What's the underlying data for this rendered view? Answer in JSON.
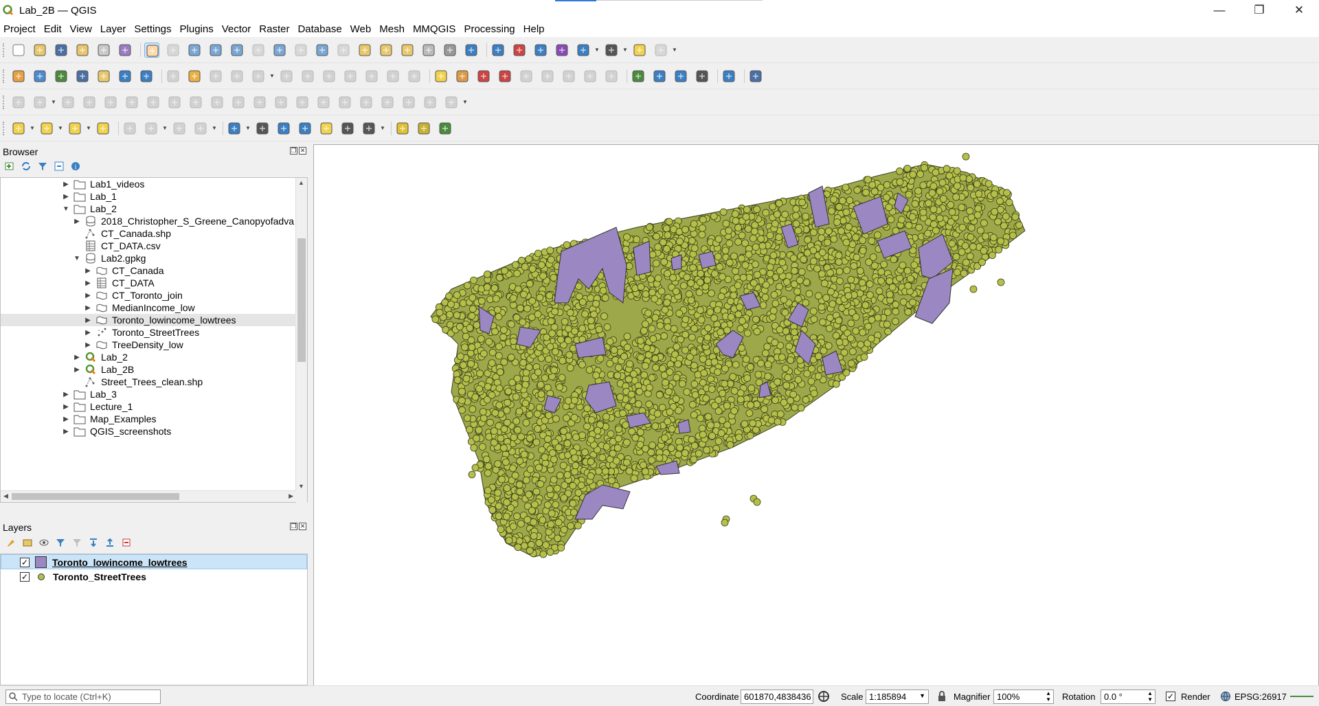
{
  "window": {
    "title": "Lab_2B — QGIS",
    "controls": {
      "minimize": "—",
      "restore": "❐",
      "close": "✕"
    }
  },
  "menu": [
    "Project",
    "Edit",
    "View",
    "Layer",
    "Settings",
    "Plugins",
    "Vector",
    "Raster",
    "Database",
    "Web",
    "Mesh",
    "MMQGIS",
    "Processing",
    "Help"
  ],
  "browser": {
    "title": "Browser",
    "items": [
      {
        "label": "Lab1_videos",
        "indent": 1,
        "arrow": "▶",
        "icon": "folder-icon"
      },
      {
        "label": "Lab_1",
        "indent": 1,
        "arrow": "▶",
        "icon": "folder-icon"
      },
      {
        "label": "Lab_2",
        "indent": 1,
        "arrow": "▼",
        "icon": "folder-icon"
      },
      {
        "label": "2018_Christopher_S_Greene_Canopyofadva",
        "indent": 2,
        "arrow": "▶",
        "icon": "database-icon"
      },
      {
        "label": "CT_Canada.shp",
        "indent": 2,
        "arrow": "",
        "icon": "shapefile-icon"
      },
      {
        "label": "CT_DATA.csv",
        "indent": 2,
        "arrow": "",
        "icon": "table-icon"
      },
      {
        "label": "Lab2.gpkg",
        "indent": 2,
        "arrow": "▼",
        "icon": "database-icon"
      },
      {
        "label": "CT_Canada",
        "indent": 3,
        "arrow": "▶",
        "icon": "polygon-layer-icon"
      },
      {
        "label": "CT_DATA",
        "indent": 3,
        "arrow": "▶",
        "icon": "table-icon"
      },
      {
        "label": "CT_Toronto_join",
        "indent": 3,
        "arrow": "▶",
        "icon": "polygon-layer-icon"
      },
      {
        "label": "MedianIncome_low",
        "indent": 3,
        "arrow": "▶",
        "icon": "polygon-layer-icon"
      },
      {
        "label": "Toronto_lowincome_lowtrees",
        "indent": 3,
        "arrow": "▶",
        "icon": "polygon-layer-icon"
      },
      {
        "label": "Toronto_StreetTrees",
        "indent": 3,
        "arrow": "▶",
        "icon": "point-layer-icon"
      },
      {
        "label": "TreeDensity_low",
        "indent": 3,
        "arrow": "▶",
        "icon": "polygon-layer-icon"
      },
      {
        "label": "Lab_2",
        "indent": 2,
        "arrow": "▶",
        "icon": "qgis-project-icon"
      },
      {
        "label": "Lab_2B",
        "indent": 2,
        "arrow": "▶",
        "icon": "qgis-project-icon"
      },
      {
        "label": "Street_Trees_clean.shp",
        "indent": 2,
        "arrow": "",
        "icon": "shapefile-icon"
      },
      {
        "label": "Lab_3",
        "indent": 1,
        "arrow": "▶",
        "icon": "folder-icon"
      },
      {
        "label": "Lecture_1",
        "indent": 1,
        "arrow": "▶",
        "icon": "folder-icon"
      },
      {
        "label": "Map_Examples",
        "indent": 1,
        "arrow": "▶",
        "icon": "folder-icon"
      },
      {
        "label": "QGIS_screenshots",
        "indent": 1,
        "arrow": "▶",
        "icon": "folder-icon"
      }
    ],
    "selected_index": 11
  },
  "layers": {
    "title": "Layers",
    "items": [
      {
        "label": "Toronto_lowincome_lowtrees",
        "checked": "✓",
        "symbol": "polygon",
        "color": "#9b87c2",
        "selected": true
      },
      {
        "label": "Toronto_StreetTrees",
        "checked": "✓",
        "symbol": "point",
        "color": "#b5c04a",
        "selected": false
      }
    ]
  },
  "colors": {
    "polygon": "#9b87c2",
    "point": "#b5c04a",
    "point_stroke": "#3b3f1c",
    "accent": "#cce4f7"
  },
  "status": {
    "locate_placeholder": "Type to locate (Ctrl+K)",
    "coordinate_label": "Coordinate",
    "coordinate_value": "601870,4838436",
    "scale_label": "Scale",
    "scale_value": "1:185894",
    "magnifier_label": "Magnifier",
    "magnifier_value": "100%",
    "rotation_label": "Rotation",
    "rotation_value": "0.0 °",
    "render_label": "Render",
    "render_checked": "✓",
    "crs": "EPSG:26917"
  }
}
